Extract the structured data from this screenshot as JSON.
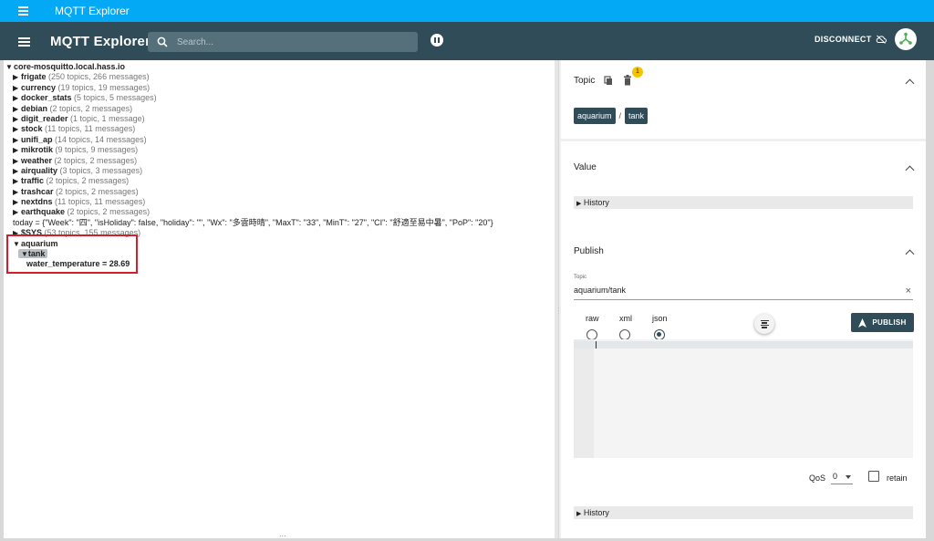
{
  "window": {
    "title": "MQTT Explorer"
  },
  "appbar": {
    "title": "MQTT Explorer",
    "search_placeholder": "Search...",
    "disconnect_label": "DISCONNECT"
  },
  "tree": {
    "root": "core-mosquitto.local.hass.io",
    "items": [
      {
        "name": "frigate",
        "meta": "(250 topics, 266 messages)"
      },
      {
        "name": "currency",
        "meta": "(19 topics, 19 messages)"
      },
      {
        "name": "docker_stats",
        "meta": "(5 topics, 5 messages)"
      },
      {
        "name": "debian",
        "meta": "(2 topics, 2 messages)"
      },
      {
        "name": "digit_reader",
        "meta": "(1 topic, 1 message)"
      },
      {
        "name": "stock",
        "meta": "(11 topics, 11 messages)"
      },
      {
        "name": "unifi_ap",
        "meta": "(14 topics, 14 messages)"
      },
      {
        "name": "mikrotik",
        "meta": "(9 topics, 9 messages)"
      },
      {
        "name": "weather",
        "meta": "(2 topics, 2 messages)"
      },
      {
        "name": "airquality",
        "meta": "(3 topics, 3 messages)"
      },
      {
        "name": "traffic",
        "meta": "(2 topics, 2 messages)"
      },
      {
        "name": "trashcar",
        "meta": "(2 topics, 2 messages)"
      },
      {
        "name": "nextdns",
        "meta": "(11 topics, 11 messages)"
      },
      {
        "name": "earthquake",
        "meta": "(2 topics, 2 messages)"
      }
    ],
    "today_value": "today = {\"Week\": \"四\", \"isHoliday\": false, \"holiday\": \"\", \"Wx\": \"多雲時晴\", \"MaxT\": \"33\", \"MinT\": \"27\", \"CI\": \"舒適至易中暑\", \"PoP\": \"20\"}",
    "sys": {
      "name": "$SYS",
      "meta": "(53 topics, 155 messages)"
    },
    "aquarium": "aquarium",
    "tank": "tank",
    "water_temperature": "water_temperature = 28.69"
  },
  "topic_panel": {
    "heading": "Topic",
    "badge": "1",
    "path": [
      "aquarium",
      "tank"
    ],
    "separator": "/"
  },
  "value_panel": {
    "heading": "Value",
    "history": "History"
  },
  "publish_panel": {
    "heading": "Publish",
    "topic_label": "Topic",
    "topic_value": "aquarium/tank",
    "clear": "×",
    "formats": [
      "raw",
      "xml",
      "json"
    ],
    "selected_format": "json",
    "publish_label": "PUBLISH",
    "qos_label": "QoS",
    "qos_value": "0",
    "retain_label": "retain",
    "history": "History"
  },
  "misc": {
    "drag_handle": "...",
    "splitter_handle": "⋮"
  }
}
